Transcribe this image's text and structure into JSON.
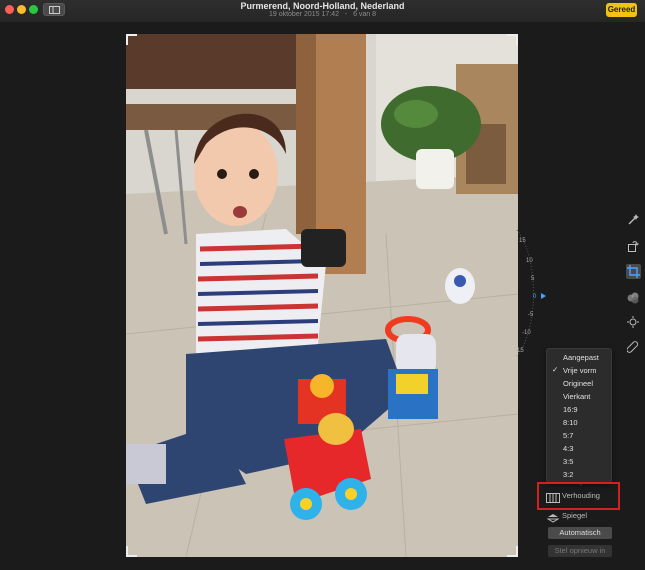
{
  "window": {
    "title": "Purmerend, Noord-Holland, Nederland",
    "date": "19 oktober 2015 17:42",
    "separator": "-",
    "position": "6 van 8",
    "done_label": "Gereed"
  },
  "crop": {
    "angle_labels": [
      "0",
      "5",
      "-5",
      "10",
      "-10",
      "15",
      "-15"
    ],
    "aspect_menu": {
      "items": [
        "Aangepast",
        "Vrije vorm",
        "Origineel",
        "Vierkant",
        "16:9",
        "8:10",
        "5:7",
        "4:3",
        "3:5",
        "3:2"
      ],
      "checked": "Vrije vorm"
    },
    "aspect_label": "Verhouding",
    "flip_label": "Spiegel",
    "auto_label": "Automatisch",
    "reset_label": "Stel opnieuw in"
  },
  "colors": {
    "accent": "#f1c20f",
    "highlight_box": "#d32020",
    "dial_marker": "#4aa3ff"
  },
  "toolbar_icons": [
    "magic-wand-icon",
    "rotate-icon",
    "crop-icon",
    "filters-icon",
    "adjust-icon",
    "retouch-icon"
  ]
}
